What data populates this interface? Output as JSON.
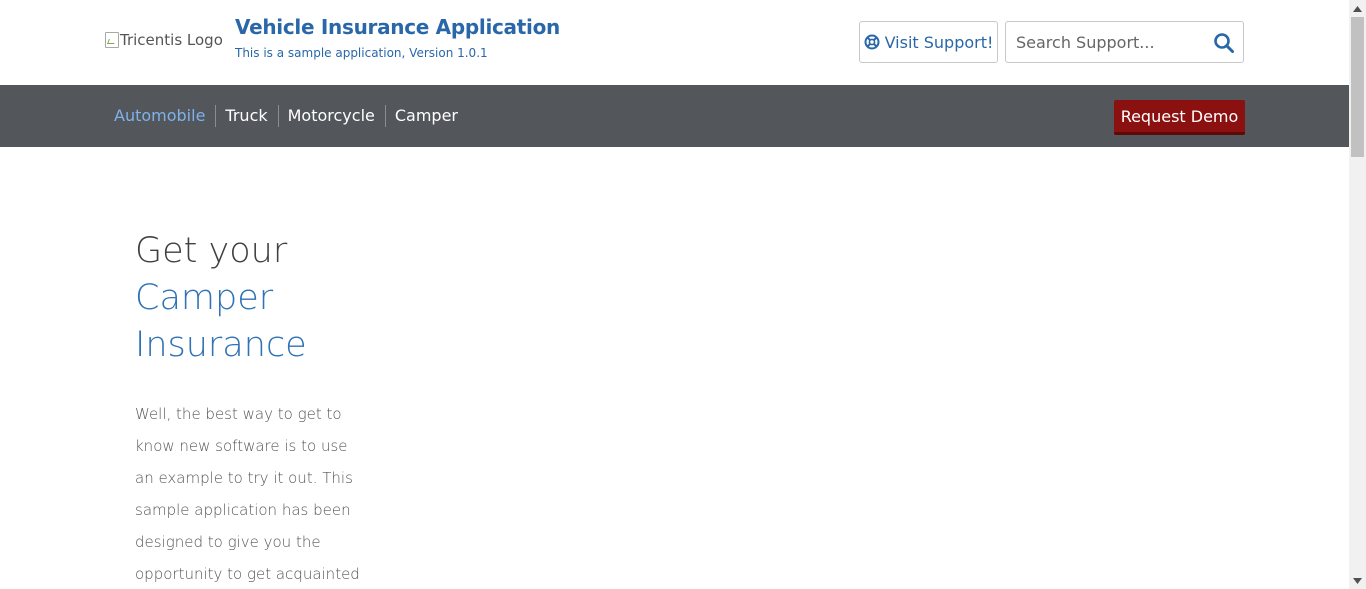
{
  "header": {
    "logo_alt": "Tricentis Logo",
    "title": "Vehicle Insurance Application",
    "subtitle": "This is a sample application, Version 1.0.1",
    "support_button": "Visit Support!",
    "search_placeholder": "Search Support..."
  },
  "nav": {
    "items": [
      {
        "label": "Automobile",
        "active": true
      },
      {
        "label": "Truck",
        "active": false
      },
      {
        "label": "Motorcycle",
        "active": false
      },
      {
        "label": "Camper",
        "active": false
      }
    ],
    "demo_button": "Request Demo"
  },
  "hero": {
    "line1": "Get your",
    "line2": "Camper",
    "line3": "Insurance"
  },
  "intro": {
    "text": "Well, the best way to get to know new software is to use an example to try it out. This sample application has been designed to give you the opportunity to get acquainted"
  },
  "colors": {
    "brand_blue": "#2a67a8",
    "nav_bg": "#53565b",
    "active_nav": "#7fb2ea",
    "demo_red": "#8b1010"
  }
}
